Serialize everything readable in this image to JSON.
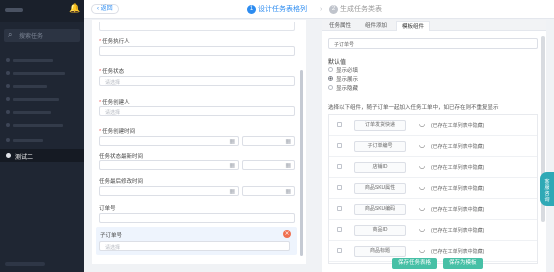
{
  "sidebar": {
    "search_placeholder": "搜索任务",
    "active_item": "测试二"
  },
  "header": {
    "back_label": "返回",
    "step1_num": "1",
    "step1_label": "设计任务表格列",
    "step_sep": "›",
    "step2_num": "2",
    "step2_label": "生成任务类表"
  },
  "form": {
    "fields": [
      {
        "label": "任务执行人",
        "required": true,
        "placeholder": ""
      },
      {
        "label": "任务状态",
        "required": true,
        "placeholder": "请选择"
      },
      {
        "label": "任务创建人",
        "required": true,
        "placeholder": "请选择"
      },
      {
        "label": "任务创建时间",
        "required": true,
        "placeholder": ""
      },
      {
        "label": "任务状态最新时间",
        "required": false,
        "placeholder": ""
      },
      {
        "label": "任务最后修改时间",
        "required": false,
        "placeholder": ""
      },
      {
        "label": "订单号",
        "required": false,
        "placeholder": ""
      },
      {
        "label": "子订单号",
        "required": false,
        "placeholder": "请选择"
      }
    ],
    "req_mark": "*",
    "delete_glyph": "×"
  },
  "rpanel": {
    "tabs": [
      "任务属性",
      "组件添加",
      "模板组件"
    ],
    "field_value": "子订单号",
    "default_title": "默认值",
    "options": [
      "显示必填",
      "显示展示",
      "显示隐藏"
    ],
    "hint": "选择以下组件，随子订单一起加入任务工单中，如已存在则不重复显示",
    "rows": [
      {
        "name": "订单发货快递",
        "note": "(已存在工单列表中隐藏)"
      },
      {
        "name": "子订单编号",
        "note": "(已存在工单列表中隐藏)"
      },
      {
        "name": "店铺ID",
        "note": "(已存在工单列表中隐藏)"
      },
      {
        "name": "商品SKU属性",
        "note": "(已存在工单列表中隐藏)"
      },
      {
        "name": "商品SKU编码",
        "note": "(已存在工单列表中隐藏)"
      },
      {
        "name": "商品ID",
        "note": "(已存在工单列表中隐藏)"
      },
      {
        "name": "商品标题",
        "note": "(已存在工单列表中隐藏)"
      }
    ],
    "eye_glyph": "◡"
  },
  "buttons": {
    "save": "保存任务表格",
    "save_as_template": "保存为模板"
  },
  "float_button": "客服咨询",
  "icons": {
    "bell": "bell-icon",
    "search": "search-icon",
    "calendar": "calendar-icon",
    "eye": "eye-closed-icon"
  },
  "colors": {
    "accent": "#2d8cf0",
    "button": "#47c0a6",
    "sidebar": "#1f2633"
  }
}
